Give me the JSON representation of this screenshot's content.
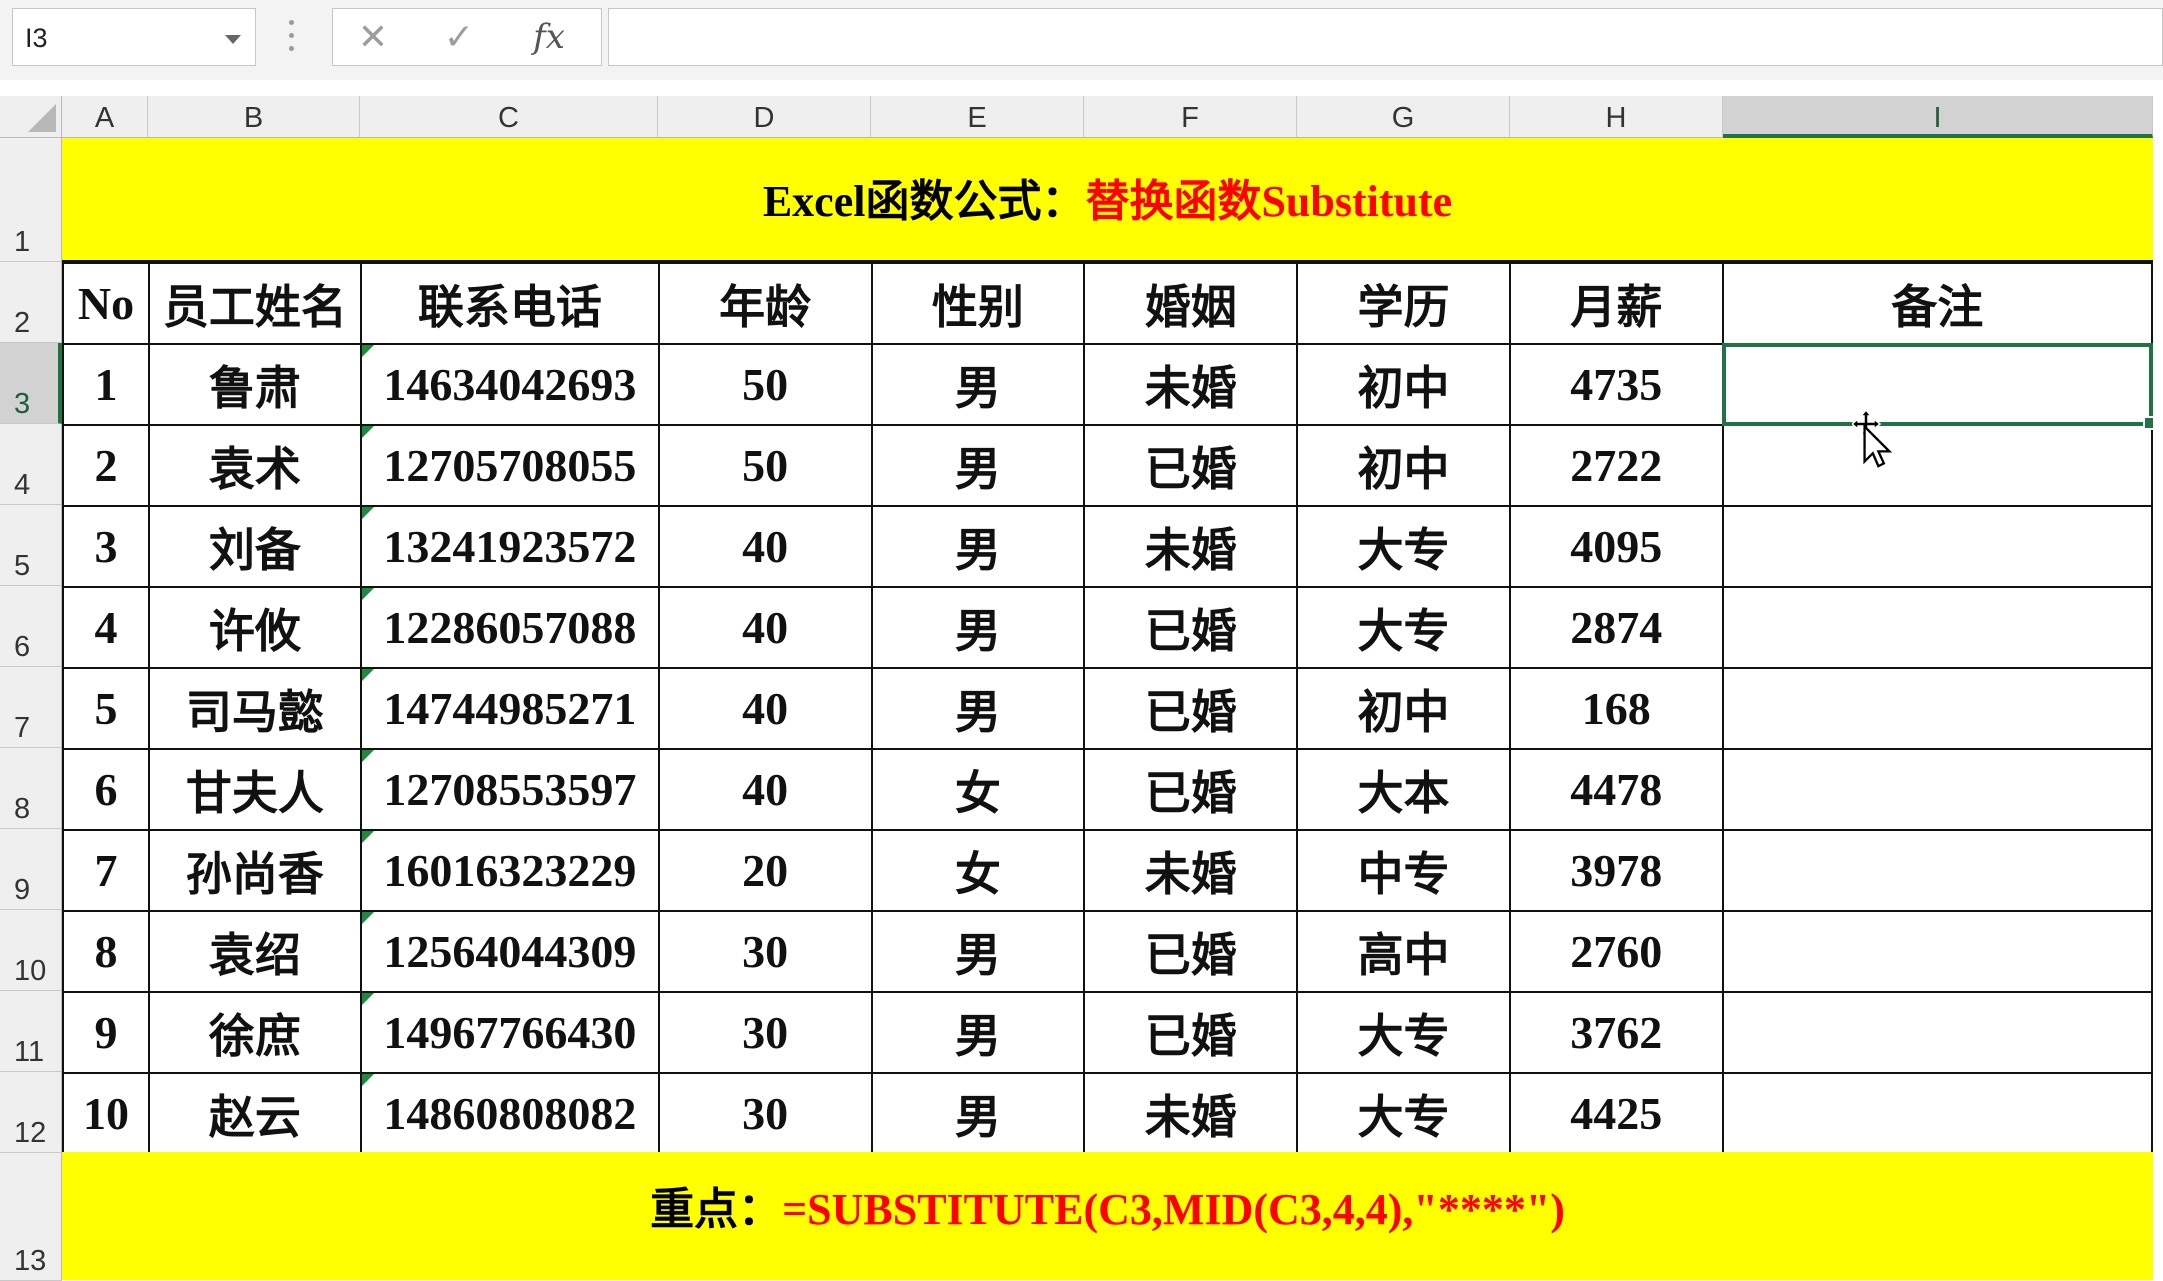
{
  "formula_bar": {
    "name_box": "I3",
    "cancel_icon": "✕",
    "enter_icon": "✓",
    "fx_label": "fx",
    "formula": ""
  },
  "columns": [
    "A",
    "B",
    "C",
    "D",
    "E",
    "F",
    "G",
    "H",
    "I"
  ],
  "selected_column": "I",
  "rows": [
    "1",
    "2",
    "3",
    "4",
    "5",
    "6",
    "7",
    "8",
    "9",
    "10",
    "11",
    "12",
    "13"
  ],
  "selected_row": "3",
  "title": {
    "part1": "Excel函数公式：",
    "part2": "替换函数Substitute"
  },
  "table": {
    "headers": [
      "No",
      "员工姓名",
      "联系电话",
      "年龄",
      "性别",
      "婚姻",
      "学历",
      "月薪",
      "备注"
    ],
    "rows": [
      [
        "1",
        "鲁肃",
        "14634042693",
        "50",
        "男",
        "未婚",
        "初中",
        "4735",
        ""
      ],
      [
        "2",
        "袁术",
        "12705708055",
        "50",
        "男",
        "已婚",
        "初中",
        "2722",
        ""
      ],
      [
        "3",
        "刘备",
        "13241923572",
        "40",
        "男",
        "未婚",
        "大专",
        "4095",
        ""
      ],
      [
        "4",
        "许攸",
        "12286057088",
        "40",
        "男",
        "已婚",
        "大专",
        "2874",
        ""
      ],
      [
        "5",
        "司马懿",
        "14744985271",
        "40",
        "男",
        "已婚",
        "初中",
        "168",
        ""
      ],
      [
        "6",
        "甘夫人",
        "12708553597",
        "40",
        "女",
        "已婚",
        "大本",
        "4478",
        ""
      ],
      [
        "7",
        "孙尚香",
        "16016323229",
        "20",
        "女",
        "未婚",
        "中专",
        "3978",
        ""
      ],
      [
        "8",
        "袁绍",
        "12564044309",
        "30",
        "男",
        "已婚",
        "高中",
        "2760",
        ""
      ],
      [
        "9",
        "徐庶",
        "14967766430",
        "30",
        "男",
        "已婚",
        "大专",
        "3762",
        ""
      ],
      [
        "10",
        "赵云",
        "14860808082",
        "30",
        "男",
        "未婚",
        "大专",
        "4425",
        ""
      ]
    ]
  },
  "note": {
    "label": "重点：",
    "formula": "=SUBSTITUTE(C3,MID(C3,4,4),\"****\")"
  },
  "colors": {
    "banner": "#ffff00",
    "highlight_text": "#ff0000",
    "selection": "#217346"
  }
}
